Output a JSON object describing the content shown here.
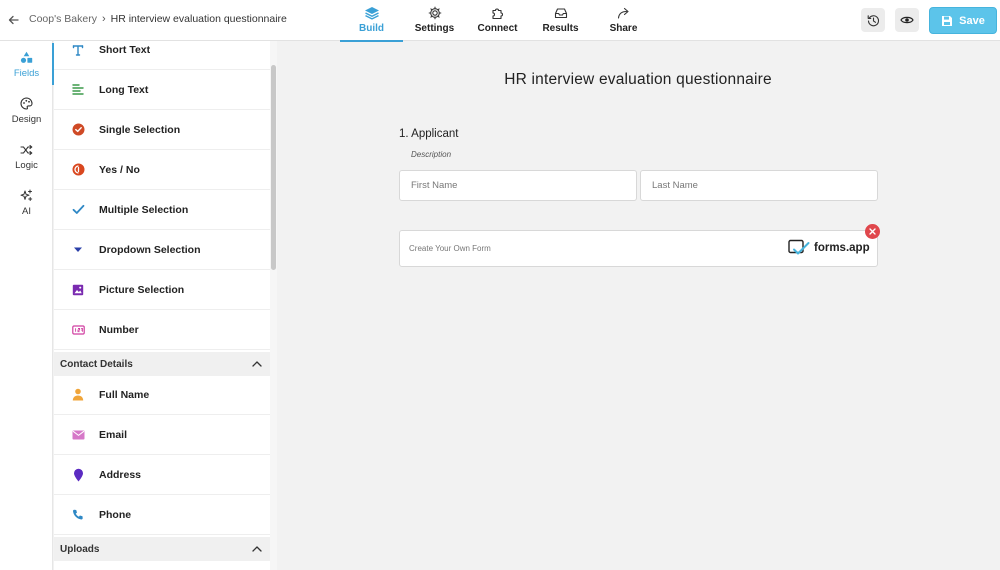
{
  "header": {
    "breadcrumb": {
      "workspace": "Coop's Bakery",
      "separator": "›",
      "form_name": "HR interview evaluation questionnaire"
    },
    "tabs": [
      {
        "label": "Build",
        "icon": "layers-icon",
        "active": true
      },
      {
        "label": "Settings",
        "icon": "gear-icon",
        "active": false
      },
      {
        "label": "Connect",
        "icon": "puzzle-icon",
        "active": false
      },
      {
        "label": "Results",
        "icon": "inbox-icon",
        "active": false
      },
      {
        "label": "Share",
        "icon": "share-arrow-icon",
        "active": false
      }
    ],
    "save_label": "Save",
    "accent_color": "#3aa0d6",
    "save_color": "#5cc4ea"
  },
  "rail": {
    "items": [
      {
        "label": "Fields",
        "icon": "shapes-icon",
        "active": true
      },
      {
        "label": "Design",
        "icon": "palette-icon",
        "active": false
      },
      {
        "label": "Logic",
        "icon": "shuffle-icon",
        "active": false
      },
      {
        "label": "AI",
        "icon": "sparkles-icon",
        "active": false
      }
    ]
  },
  "fields_panel": {
    "basic_fields": [
      {
        "label": "Short Text",
        "icon": "text-t-icon"
      },
      {
        "label": "Long Text",
        "icon": "text-lines-icon"
      },
      {
        "label": "Single Selection",
        "icon": "radio-check-icon"
      },
      {
        "label": "Yes / No",
        "icon": "yes-no-icon"
      },
      {
        "label": "Multiple Selection",
        "icon": "checkmark-icon"
      },
      {
        "label": "Dropdown Selection",
        "icon": "dropdown-caret-icon"
      },
      {
        "label": "Picture Selection",
        "icon": "picture-icon"
      },
      {
        "label": "Number",
        "icon": "number-icon"
      }
    ],
    "contact_section": {
      "title": "Contact Details",
      "items": [
        {
          "label": "Full Name",
          "icon": "person-icon"
        },
        {
          "label": "Email",
          "icon": "envelope-icon"
        },
        {
          "label": "Address",
          "icon": "map-pin-icon"
        },
        {
          "label": "Phone",
          "icon": "phone-icon"
        }
      ]
    },
    "uploads_section": {
      "title": "Uploads"
    }
  },
  "canvas": {
    "title": "HR interview evaluation questionnaire",
    "question": {
      "label": "1. Applicant",
      "description": "Description",
      "first_name_placeholder": "First Name",
      "last_name_placeholder": "Last Name"
    },
    "branding": {
      "text": "Create Your Own Form",
      "logo_text": "forms.app"
    }
  }
}
